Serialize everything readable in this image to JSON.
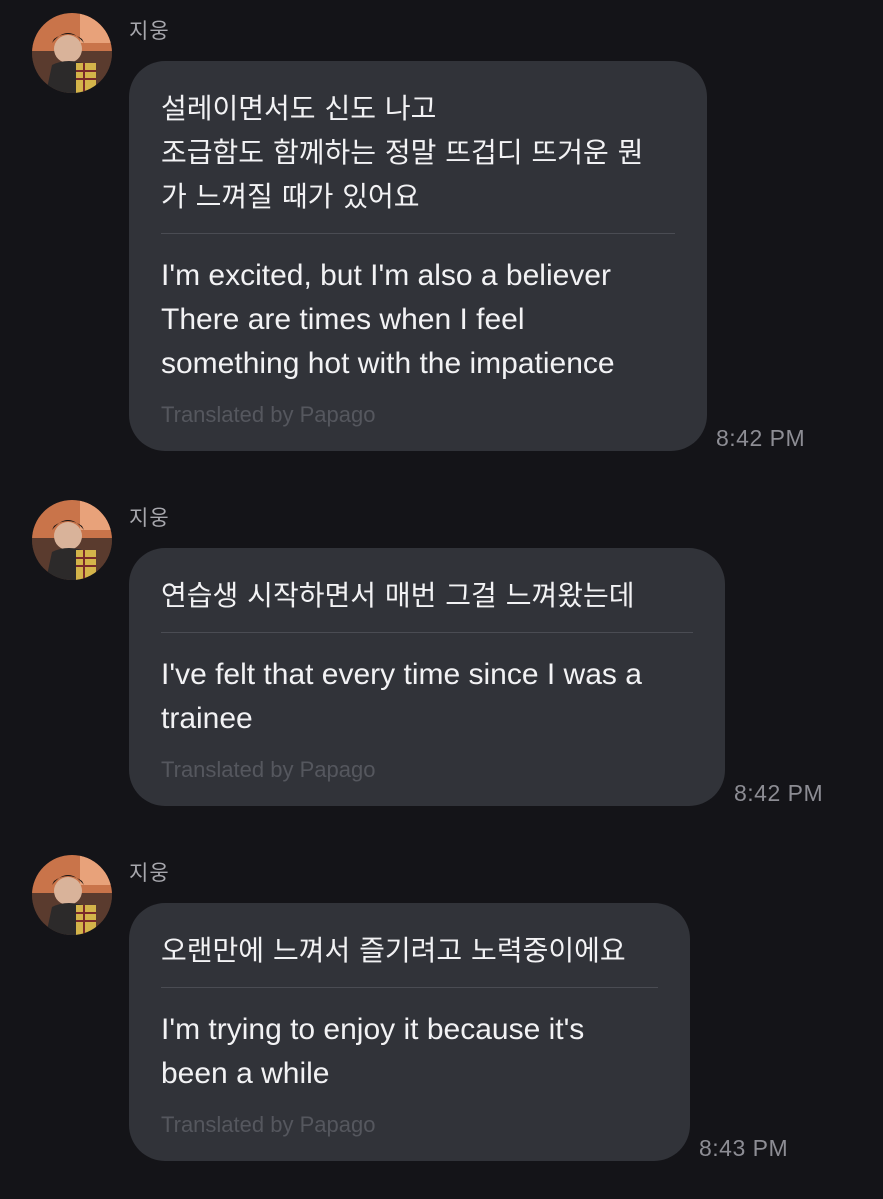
{
  "conversation": {
    "messages": [
      {
        "sender": "지웅",
        "avatar": "avatar-photo",
        "original": "설레이면서도 신도 나고\n조급함도 함께하는 정말 뜨겁디 뜨거운 뭔\n가 느껴질 때가 있어요",
        "translation": "I'm excited, but I'm also a believer\nThere are times when I feel\nsomething hot with the impatience",
        "credit": "Translated by Papago",
        "time": "8:42 PM"
      },
      {
        "sender": "지웅",
        "avatar": "avatar-photo",
        "original": "연습생 시작하면서 매번 그걸 느껴왔는데",
        "translation": "I've felt that every time since I was a\ntrainee",
        "credit": "Translated by Papago",
        "time": "8:42 PM"
      },
      {
        "sender": "지웅",
        "avatar": "avatar-photo",
        "original": "오랜만에 느껴서 즐기려고 노력중이에요",
        "translation": "I'm trying to enjoy it because it's\nbeen a while",
        "credit": "Translated by Papago",
        "time": "8:43 PM"
      }
    ]
  },
  "colors": {
    "background": "#141418",
    "bubble": "#313339",
    "text": "#f2f2f4",
    "meta": "#8d8d94"
  }
}
